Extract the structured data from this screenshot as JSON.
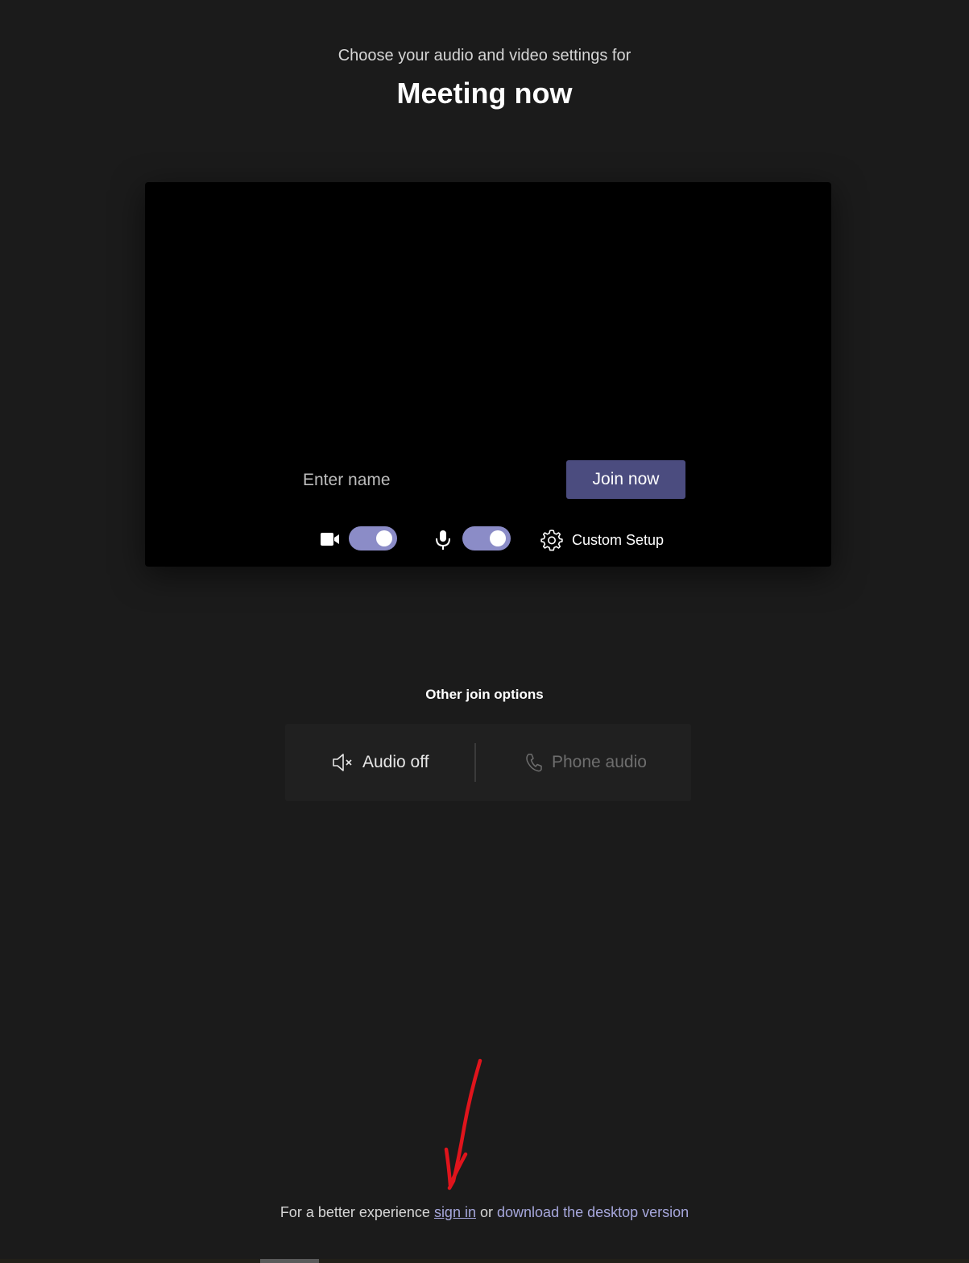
{
  "header": {
    "subtitle": "Choose your audio and video settings for",
    "meeting_title": "Meeting now"
  },
  "prejoin": {
    "name_placeholder": "Enter name",
    "name_value": "",
    "join_label": "Join now",
    "camera_toggle_on": true,
    "mic_toggle_on": true,
    "custom_setup_label": "Custom Setup",
    "icons": {
      "camera": "video-camera-icon",
      "mic": "microphone-icon",
      "settings": "gear-icon"
    }
  },
  "other_options": {
    "title": "Other join options",
    "audio_off_label": "Audio off",
    "phone_audio_label": "Phone audio",
    "icons": {
      "audio_off": "speaker-muted-icon",
      "phone": "phone-icon"
    }
  },
  "footer": {
    "prefix": "For a better experience",
    "sign_in": "sign in",
    "or": "or",
    "download": "download the desktop version"
  },
  "colors": {
    "background": "#1b1b1b",
    "accent": "#4b4c7f",
    "toggle_on": "#8b8cc7",
    "link": "#a6a7dc",
    "annotation": "#e0141c"
  }
}
